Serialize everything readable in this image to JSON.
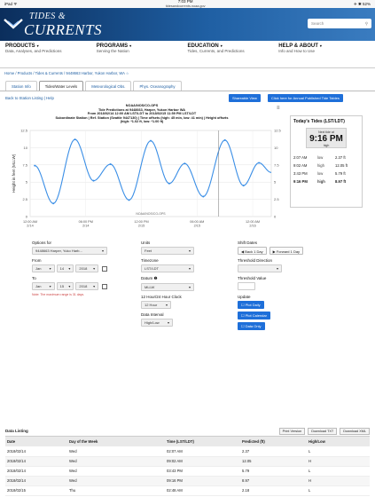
{
  "statusbar": {
    "left": "iPad ᯤ",
    "time": "7:03 PM",
    "url": "tidesandcurrents.noaa.gov",
    "right": "✈ ✱ 52%"
  },
  "banner": {
    "logo_line1": "TIDES &",
    "logo_line2": "CURRENTS",
    "search_placeholder": "Search"
  },
  "nav": [
    {
      "title": "PRODUCTS",
      "sub": "Data, Analyses, and Predictions"
    },
    {
      "title": "PROGRAMS",
      "sub": "Serving the Nation"
    },
    {
      "title": "EDUCATION",
      "sub": "Tides, Currents, and Predictions"
    },
    {
      "title": "HELP & ABOUT",
      "sub": "Info and How to Use"
    }
  ],
  "breadcrumb": "Home / Products / Tides & Currents / 9448663 Harbor, Yukon Harbor, WA ☆",
  "tabs": [
    "Station Info",
    "Tides/Water Levels",
    "Meteorological Obs.",
    "Phys. Oceanography"
  ],
  "action_links": "Back to Station Listing | Help",
  "buttons": {
    "shareable": "Shareable View",
    "click_here": "Click here for Annual Published Tide Tables"
  },
  "chart_titles": [
    "NOAA/NOS/CO-OPS",
    "Tide Predictions at 9448663, Harper, Yukon Harbor WA",
    "From 2018/02/14 12:00 AM LST/LDT to 2018/02/15 11:59 PM LST/LDT",
    "Subordinate Station | Ref. Station (Seattle 9447130) | Time offsets (high: 45 min, low: 41 min) | Height offsets",
    "(high: *1.02 ft, low: *1.00 ft)"
  ],
  "chart_menu_icon": "hamburger-menu",
  "chart_data": {
    "type": "line",
    "title": "NOAA/NOS/CO-OPS",
    "ylabel": "Height in feet (MLLW)",
    "xlabel": "NOAA/NOS/CO-OPS",
    "ylim": [
      0,
      12.5
    ],
    "y_ticks": [
      0,
      2.5,
      5,
      7.5,
      10,
      12.5
    ],
    "x_tick_labels": [
      {
        "time": "12:00 AM",
        "date": "2/14",
        "hour": 0
      },
      {
        "time": "06:00 PM",
        "date": "2/14",
        "hour": 18
      },
      {
        "time": "12:00 PM",
        "date": "2/15",
        "hour": 36
      },
      {
        "time": "06:00 AM",
        "date": "2/15",
        "hour": 54
      },
      {
        "time": "12:00 AM",
        "date": "2/16",
        "hour": 72
      }
    ],
    "x_range_hours": [
      0,
      78
    ],
    "series": [
      {
        "color": "#3a8ee6",
        "extrema": [
          {
            "hour": 1.5,
            "value": 7.4
          },
          {
            "hour": 7.5,
            "value": 1.9
          },
          {
            "hour": 14.5,
            "value": 11.2
          },
          {
            "hour": 20.5,
            "value": 5.2
          },
          {
            "hour": 26,
            "value": 7.6
          },
          {
            "hour": 32,
            "value": 2.4
          },
          {
            "hour": 39,
            "value": 11.0
          },
          {
            "hour": 45,
            "value": 4.8
          },
          {
            "hour": 50,
            "value": 7.7
          },
          {
            "hour": 56,
            "value": 2.9
          },
          {
            "hour": 63,
            "value": 11.1
          },
          {
            "hour": 69,
            "value": 4.5
          },
          {
            "hour": 74,
            "value": 7.8
          },
          {
            "hour": 78,
            "value": 6.4
          }
        ]
      }
    ],
    "now_marker_hour": 61
  },
  "todays_tides": {
    "header": "Today's Tides (LST/LDT)",
    "next_label": "Next tide at",
    "next_time": "9:16 PM",
    "next_kind": "high",
    "rows": [
      {
        "time": "2:07 AM",
        "kind": "low",
        "height": "2.37 ft",
        "bold": false
      },
      {
        "time": "9:02 AM",
        "kind": "high",
        "height": "12.05 ft",
        "bold": false
      },
      {
        "time": "3:43 PM",
        "kind": "low",
        "height": "5.79 ft",
        "bold": false
      },
      {
        "time": "9:16 PM",
        "kind": "high",
        "height": "8.97 ft",
        "bold": true
      }
    ]
  },
  "options": {
    "options_for_label": "Options for",
    "options_for_value": "9448663 Harper, Yuko Harb...",
    "from_label": "From",
    "from": {
      "month": "Jan",
      "day": "14",
      "year": "2018"
    },
    "to_label": "To",
    "to": {
      "month": "Jan",
      "day": "15",
      "year": "2018"
    },
    "note": "Note: The maximum range is 31 days.",
    "units_label": "Units",
    "units_value": "Feet",
    "timezone_label": "Timezone",
    "timezone_value": "LST/LDT",
    "datum_label": "Datum ❷",
    "datum_value": "MLLW",
    "clock_label": "12 Hour/24 Hour Clock",
    "clock_value": "12 Hour",
    "interval_label": "Data Interval",
    "interval_value": "High/Low",
    "shift_label": "Shift Dates",
    "back_btn": "Back 1 Day",
    "forward_btn": "Forward 1 Day",
    "threshold_dir_label": "Threshold Direction",
    "threshold_val_label": "Threshold Value",
    "update_label": "Update",
    "plot_daily": "Plot Daily",
    "plot_calendar": "Plot Calendar",
    "data_only": "Data Only"
  },
  "data_listing": {
    "title": "Data Listing",
    "buttons": [
      "Print Version",
      "Download TXT",
      "Download XML"
    ],
    "columns": [
      "Date",
      "Day of the Week",
      "Time (LST/LDT)",
      "Predicted (ft)",
      "High/Low"
    ],
    "rows": [
      [
        "2018/02/14",
        "Wed",
        "02:07 AM",
        "2.37",
        "L"
      ],
      [
        "2018/02/14",
        "Wed",
        "09:02 AM",
        "12.05",
        "H"
      ],
      [
        "2018/02/14",
        "Wed",
        "03:43 PM",
        "5.79",
        "L"
      ],
      [
        "2018/02/14",
        "Wed",
        "09:16 PM",
        "8.97",
        "H"
      ],
      [
        "2018/02/15",
        "Thu",
        "02:48 AM",
        "2.18",
        "L"
      ]
    ]
  }
}
